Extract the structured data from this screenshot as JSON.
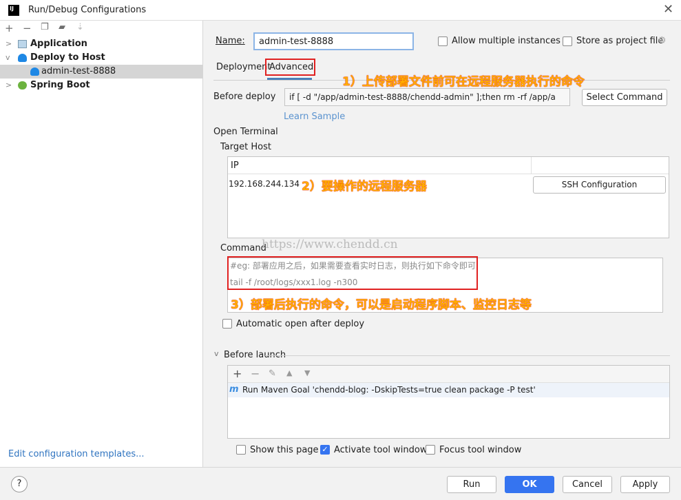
{
  "window": {
    "title": "Run/Debug Configurations",
    "logo": "IJ"
  },
  "toolbar": {
    "icons": [
      "add-icon",
      "remove-icon",
      "copy-icon",
      "folder-add-icon",
      "sort-icon"
    ]
  },
  "tree": [
    {
      "label": "Application",
      "icon": "application-icon",
      "expanded": false
    },
    {
      "label": "Deploy to Host",
      "icon": "cloud-upload-icon",
      "expanded": true
    },
    {
      "label": "admin-test-8888",
      "icon": "cloud-upload-icon",
      "selected": true
    },
    {
      "label": "Spring Boot",
      "icon": "spring-boot-icon",
      "expanded": false
    }
  ],
  "edit_templates": "Edit configuration templates...",
  "form": {
    "name_label": "Name:",
    "name_value": "admin-test-8888",
    "allow_multiple": "Allow multiple instances",
    "allow_multiple_checked": false,
    "store_project": "Store as project file",
    "store_project_checked": false,
    "tabs": [
      "Deployment",
      "Advanced"
    ],
    "active_tab": "Advanced",
    "before_deploy_label": "Before deploy",
    "before_deploy_value": "if [ -d \"/app/admin-test-8888/chendd-admin\" ];then        rm -rf /app/a",
    "select_command": "Select Command",
    "learn_sample": "Learn Sample",
    "open_terminal": "Open Terminal",
    "target_host": "Target Host",
    "table": {
      "header": "IP",
      "rows": [
        {
          "ip": "192.168.244.134",
          "button": "SSH Configuration"
        }
      ]
    },
    "command_label": "Command",
    "command_lines": [
      "#eg: 部署应用之后，如果需要查看实时日志，则执行如下命令即可",
      "tail -f /root/logs/xxx1.log -n300"
    ],
    "auto_open": "Automatic open after deploy",
    "auto_open_checked": false,
    "before_launch": "Before launch",
    "launch_task": "Run Maven Goal 'chendd-blog: -DskipTests=true clean package -P test'",
    "show_page": "Show this page",
    "show_page_checked": false,
    "activate_tool": "Activate tool window",
    "activate_tool_checked": true,
    "focus_tool": "Focus tool window",
    "focus_tool_checked": false
  },
  "annotations": [
    "1）上传部署文件前可在远程服务器执行的命令",
    "2）要操作的远程服务器",
    "3）部署后执行的命令，可以是启动程序脚本、监控日志等"
  ],
  "watermark": "https://www.chendd.cn",
  "footer": {
    "help": "?",
    "run": "Run",
    "ok": "OK",
    "cancel": "Cancel",
    "apply": "Apply"
  },
  "colors": {
    "accent": "#3574f0",
    "link": "#2f74c0",
    "annotation": "#ffae00",
    "highlight_box": "#e02020"
  }
}
